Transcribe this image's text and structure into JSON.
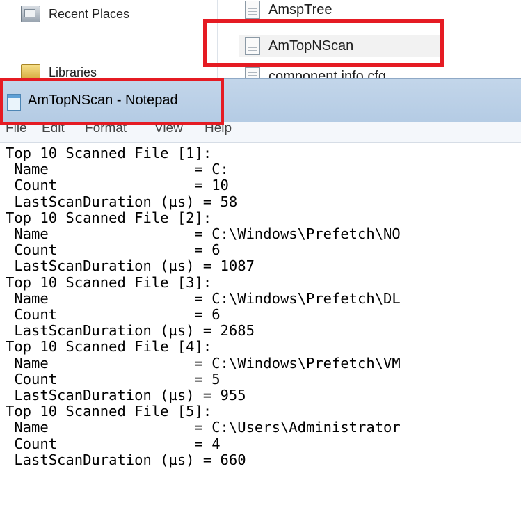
{
  "explorer": {
    "nav_items": [
      {
        "label": "Recent Places",
        "icon": "recent-places-icon"
      },
      {
        "label": "Libraries",
        "icon": "libraries-folder-icon"
      }
    ],
    "files": [
      {
        "name": "AmspTree"
      },
      {
        "name": "AmTopNScan"
      },
      {
        "name": "component.info.cfg"
      }
    ]
  },
  "notepad": {
    "title": "AmTopNScan - Notepad",
    "menu": [
      "File",
      "Edit",
      "Format",
      "View",
      "Help"
    ],
    "lines": [
      "Top 10 Scanned File [1]:",
      " Name                 = C:",
      " Count                = 10",
      " LastScanDuration (µs) = 58",
      "Top 10 Scanned File [2]:",
      " Name                 = C:\\Windows\\Prefetch\\NO",
      " Count                = 6",
      " LastScanDuration (µs) = 1087",
      "Top 10 Scanned File [3]:",
      " Name                 = C:\\Windows\\Prefetch\\DL",
      " Count                = 6",
      " LastScanDuration (µs) = 2685",
      "Top 10 Scanned File [4]:",
      " Name                 = C:\\Windows\\Prefetch\\VM",
      " Count                = 5",
      " LastScanDuration (µs) = 955",
      "Top 10 Scanned File [5]:",
      " Name                 = C:\\Users\\Administrator",
      " Count                = 4",
      " LastScanDuration (µs) = 660"
    ]
  },
  "colors": {
    "highlight": "#e51b23",
    "titlebar": "#bcd0e7"
  }
}
